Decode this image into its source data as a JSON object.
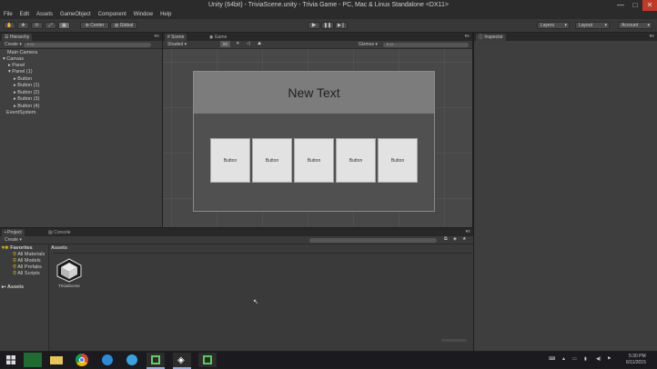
{
  "window": {
    "title": "Unity (64bit) - TriviaScene.unity - Trivia Game - PC, Mac & Linux Standalone <DX11>",
    "min": "—",
    "max": "□",
    "close": "✕"
  },
  "menu": [
    "File",
    "Edit",
    "Assets",
    "GameObject",
    "Component",
    "Window",
    "Help"
  ],
  "toolbar": {
    "pivot": "Center",
    "space": "Global",
    "layers": "Layers",
    "layout": "Layout",
    "account": "Account"
  },
  "hierarchy": {
    "tab": "Hierarchy",
    "create": "Create",
    "search_placeholder": "▼All",
    "items": [
      "Main Camera",
      "Canvas",
      "Panel",
      "Panel (1)",
      "Button",
      "Button (1)",
      "Button (2)",
      "Button (3)",
      "Button (4)",
      "EventSystem"
    ]
  },
  "scene": {
    "tab": "Scene",
    "game_tab": "Game",
    "shading": "Shaded",
    "mode2d": "2D",
    "gizmos": "Gizmos",
    "search_placeholder": "▼All"
  },
  "canvas": {
    "title_text": "New Text",
    "buttons": [
      "Button",
      "Button",
      "Button",
      "Button",
      "Button"
    ]
  },
  "inspector": {
    "tab": "Inspector"
  },
  "project": {
    "tab": "Project",
    "console_tab": "Console",
    "create": "Create",
    "favorites_label": "Favorites",
    "favorites": [
      "All Materials",
      "All Models",
      "All Prefabs",
      "All Scripts"
    ],
    "assets_label": "Assets",
    "assets_header": "Assets",
    "asset_name": "TriviaScene"
  },
  "taskbar": {
    "time": "5:30 PM",
    "date": "6/11/2015"
  }
}
